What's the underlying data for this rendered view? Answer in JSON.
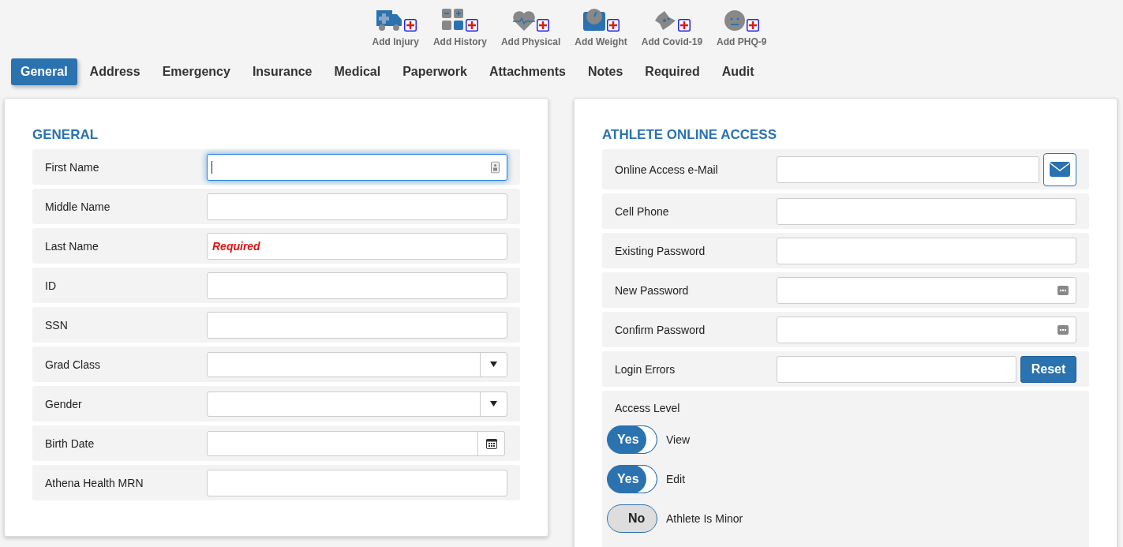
{
  "toolbar": [
    {
      "label": "Add Injury",
      "kind": "injury"
    },
    {
      "label": "Add History",
      "kind": "history"
    },
    {
      "label": "Add Physical",
      "kind": "physical"
    },
    {
      "label": "Add Weight",
      "kind": "weight"
    },
    {
      "label": "Add Covid-19",
      "kind": "covid"
    },
    {
      "label": "Add PHQ-9",
      "kind": "phq"
    }
  ],
  "tabs": [
    {
      "label": "General",
      "selected": true
    },
    {
      "label": "Address",
      "selected": false
    },
    {
      "label": "Emergency",
      "selected": false
    },
    {
      "label": "Insurance",
      "selected": false
    },
    {
      "label": "Medical",
      "selected": false
    },
    {
      "label": "Paperwork",
      "selected": false
    },
    {
      "label": "Attachments",
      "selected": false
    },
    {
      "label": "Notes",
      "selected": false
    },
    {
      "label": "Required",
      "selected": false
    },
    {
      "label": "Audit",
      "selected": false
    }
  ],
  "general": {
    "title": "GENERAL",
    "fields": [
      {
        "label": "First Name",
        "kind": "contact",
        "focused": true
      },
      {
        "label": "Middle Name",
        "kind": "text",
        "focused": false
      },
      {
        "label": "Last Name",
        "kind": "text",
        "focused": false,
        "placeholder": "Required"
      },
      {
        "label": "ID",
        "kind": "text",
        "focused": false
      },
      {
        "label": "SSN",
        "kind": "text",
        "focused": false
      },
      {
        "label": "Grad Class",
        "kind": "select",
        "focused": false
      },
      {
        "label": "Gender",
        "kind": "select",
        "focused": false
      },
      {
        "label": "Birth Date",
        "kind": "date",
        "focused": false
      },
      {
        "label": "Athena Health MRN",
        "kind": "text",
        "focused": false
      }
    ]
  },
  "online_access": {
    "title": "ATHLETE ONLINE ACCESS",
    "fields": [
      {
        "label": "Online Access e-Mail",
        "kind": "email"
      },
      {
        "label": "Cell Phone",
        "kind": "text"
      },
      {
        "label": "Existing Password",
        "kind": "text"
      },
      {
        "label": "New Password",
        "kind": "password"
      },
      {
        "label": "Confirm Password",
        "kind": "password"
      },
      {
        "label": "Login Errors",
        "kind": "reset",
        "button": "Reset"
      }
    ],
    "access_level": {
      "label": "Access Level",
      "toggles": [
        {
          "label": "View",
          "state_text": "Yes",
          "on": true
        },
        {
          "label": "Edit",
          "state_text": "Yes",
          "on": true
        },
        {
          "label": "Athlete Is Minor",
          "state_text": "No",
          "on": false
        }
      ]
    }
  }
}
